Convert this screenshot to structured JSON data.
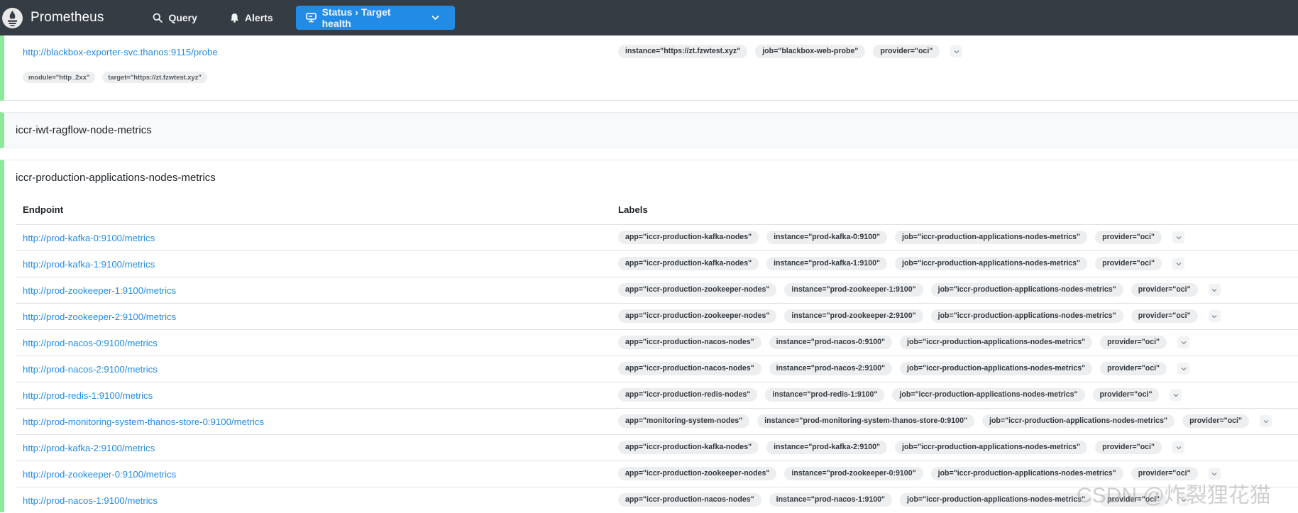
{
  "nav": {
    "brand": "Prometheus",
    "query": "Query",
    "alerts": "Alerts",
    "status": "Status › Target health"
  },
  "pool1": {
    "endpoint": "http://blackbox-exporter-svc.thanos:9115/probe",
    "labels": [
      "instance=\"https://zt.fzwtest.xyz\"",
      "job=\"blackbox-web-probe\"",
      "provider=\"oci\""
    ],
    "params": [
      "module=\"http_2xx\"",
      "target=\"https://zt.fzwtest.xyz\""
    ]
  },
  "pool2": {
    "name": "iccr-iwt-ragflow-node-metrics"
  },
  "pool3": {
    "name": "iccr-production-applications-nodes-metrics",
    "col_endpoint": "Endpoint",
    "col_labels": "Labels",
    "rows": [
      {
        "endpoint": "http://prod-kafka-0:9100/metrics",
        "labels": [
          "app=\"iccr-production-kafka-nodes\"",
          "instance=\"prod-kafka-0:9100\"",
          "job=\"iccr-production-applications-nodes-metrics\"",
          "provider=\"oci\""
        ]
      },
      {
        "endpoint": "http://prod-kafka-1:9100/metrics",
        "labels": [
          "app=\"iccr-production-kafka-nodes\"",
          "instance=\"prod-kafka-1:9100\"",
          "job=\"iccr-production-applications-nodes-metrics\"",
          "provider=\"oci\""
        ]
      },
      {
        "endpoint": "http://prod-zookeeper-1:9100/metrics",
        "labels": [
          "app=\"iccr-production-zookeeper-nodes\"",
          "instance=\"prod-zookeeper-1:9100\"",
          "job=\"iccr-production-applications-nodes-metrics\"",
          "provider=\"oci\""
        ]
      },
      {
        "endpoint": "http://prod-zookeeper-2:9100/metrics",
        "labels": [
          "app=\"iccr-production-zookeeper-nodes\"",
          "instance=\"prod-zookeeper-2:9100\"",
          "job=\"iccr-production-applications-nodes-metrics\"",
          "provider=\"oci\""
        ]
      },
      {
        "endpoint": "http://prod-nacos-0:9100/metrics",
        "labels": [
          "app=\"iccr-production-nacos-nodes\"",
          "instance=\"prod-nacos-0:9100\"",
          "job=\"iccr-production-applications-nodes-metrics\"",
          "provider=\"oci\""
        ]
      },
      {
        "endpoint": "http://prod-nacos-2:9100/metrics",
        "labels": [
          "app=\"iccr-production-nacos-nodes\"",
          "instance=\"prod-nacos-2:9100\"",
          "job=\"iccr-production-applications-nodes-metrics\"",
          "provider=\"oci\""
        ]
      },
      {
        "endpoint": "http://prod-redis-1:9100/metrics",
        "labels": [
          "app=\"iccr-production-redis-nodes\"",
          "instance=\"prod-redis-1:9100\"",
          "job=\"iccr-production-applications-nodes-metrics\"",
          "provider=\"oci\""
        ]
      },
      {
        "endpoint": "http://prod-monitoring-system-thanos-store-0:9100/metrics",
        "labels": [
          "app=\"monitoring-system-nodes\"",
          "instance=\"prod-monitoring-system-thanos-store-0:9100\"",
          "job=\"iccr-production-applications-nodes-metrics\"",
          "provider=\"oci\""
        ]
      },
      {
        "endpoint": "http://prod-kafka-2:9100/metrics",
        "labels": [
          "app=\"iccr-production-kafka-nodes\"",
          "instance=\"prod-kafka-2:9100\"",
          "job=\"iccr-production-applications-nodes-metrics\"",
          "provider=\"oci\""
        ]
      },
      {
        "endpoint": "http://prod-zookeeper-0:9100/metrics",
        "labels": [
          "app=\"iccr-production-zookeeper-nodes\"",
          "instance=\"prod-zookeeper-0:9100\"",
          "job=\"iccr-production-applications-nodes-metrics\"",
          "provider=\"oci\""
        ]
      },
      {
        "endpoint": "http://prod-nacos-1:9100/metrics",
        "labels": [
          "app=\"iccr-production-nacos-nodes\"",
          "instance=\"prod-nacos-1:9100\"",
          "job=\"iccr-production-applications-nodes-metrics\"",
          "provider=\"oci\""
        ]
      }
    ]
  },
  "watermark": "CSDN @炸裂狸花猫",
  "colors": {
    "navbar": "#363c43",
    "accent": "#228be6",
    "health_bar": "#8ce99a"
  }
}
